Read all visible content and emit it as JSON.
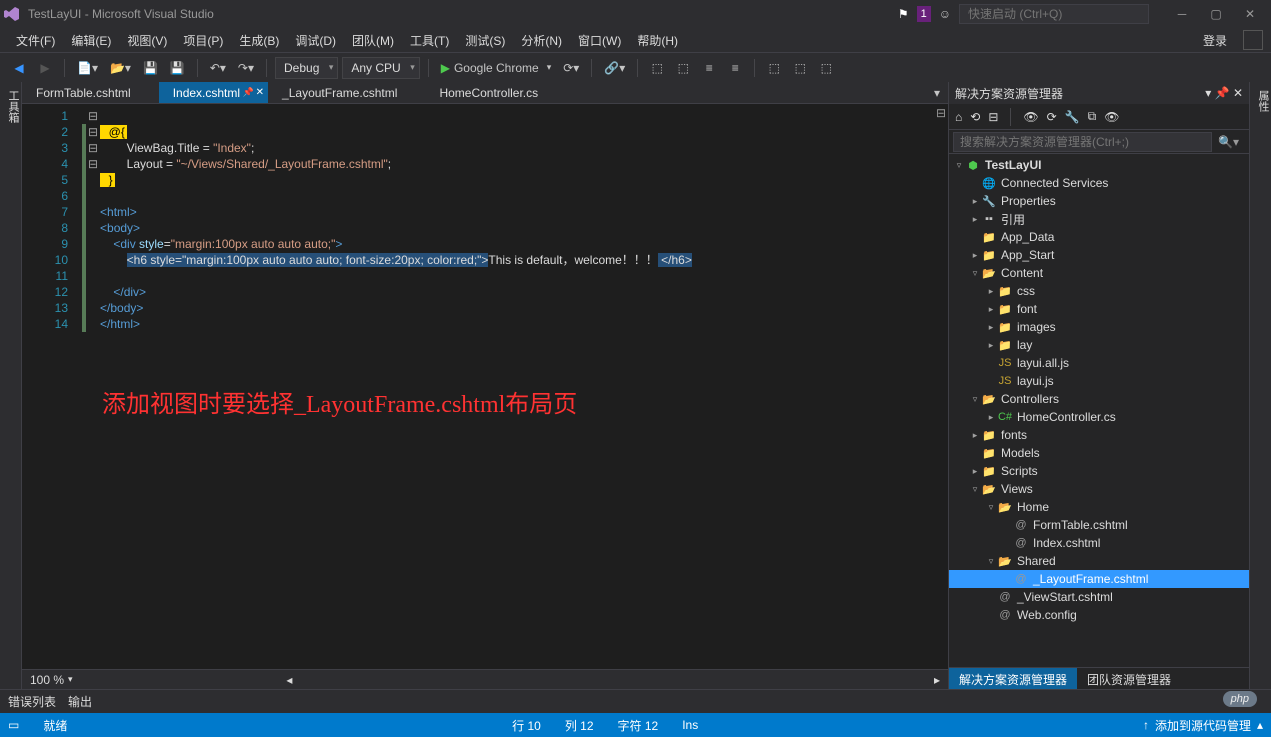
{
  "titlebar": {
    "title": "TestLayUI - Microsoft Visual Studio",
    "notification_count": "1",
    "quick_launch_placeholder": "快速启动 (Ctrl+Q)"
  },
  "menubar": {
    "items": [
      "文件(F)",
      "编辑(E)",
      "视图(V)",
      "项目(P)",
      "生成(B)",
      "调试(D)",
      "团队(M)",
      "工具(T)",
      "测试(S)",
      "分析(N)",
      "窗口(W)",
      "帮助(H)"
    ],
    "login": "登录"
  },
  "toolbar": {
    "config": "Debug",
    "platform": "Any CPU",
    "start_target": "Google Chrome"
  },
  "left_strip": "工具箱",
  "right_strip": "属性",
  "tabs": [
    {
      "label": "FormTable.cshtml",
      "active": false
    },
    {
      "label": "Index.cshtml",
      "active": true,
      "pinned": true
    },
    {
      "label": "_LayoutFrame.cshtml",
      "active": false
    },
    {
      "label": "HomeController.cs",
      "active": false
    }
  ],
  "code": {
    "lines": [
      {
        "n": 1,
        "segs": []
      },
      {
        "n": 2,
        "segs": [
          {
            "t": "@{",
            "c": "tok-yellow-box",
            "indent": 2
          }
        ]
      },
      {
        "n": 3,
        "segs": [
          {
            "t": "ViewBag.Title = ",
            "c": "tok-text",
            "indent": 8
          },
          {
            "t": "\"Index\"",
            "c": "tok-str"
          },
          {
            "t": ";",
            "c": "tok-text"
          }
        ]
      },
      {
        "n": 4,
        "segs": [
          {
            "t": "Layout = ",
            "c": "tok-text",
            "indent": 8
          },
          {
            "t": "\"~/Views/Shared/_LayoutFrame.cshtml\"",
            "c": "tok-str"
          },
          {
            "t": ";",
            "c": "tok-text"
          }
        ]
      },
      {
        "n": 5,
        "segs": [
          {
            "t": "}",
            "c": "tok-yellow-box",
            "indent": 2
          }
        ]
      },
      {
        "n": 6,
        "segs": []
      },
      {
        "n": 7,
        "segs": [
          {
            "t": "<",
            "c": "tok-tag",
            "indent": 0
          },
          {
            "t": "html",
            "c": "tok-tag"
          },
          {
            "t": ">",
            "c": "tok-tag"
          }
        ]
      },
      {
        "n": 8,
        "segs": [
          {
            "t": "<",
            "c": "tok-tag",
            "indent": 0
          },
          {
            "t": "body",
            "c": "tok-tag"
          },
          {
            "t": ">",
            "c": "tok-tag"
          }
        ]
      },
      {
        "n": 9,
        "segs": [
          {
            "t": "    ",
            "c": "tok-text"
          },
          {
            "t": "<",
            "c": "tok-tag"
          },
          {
            "t": "div ",
            "c": "tok-tag"
          },
          {
            "t": "style",
            "c": "tok-attr"
          },
          {
            "t": "=",
            "c": "tok-punct"
          },
          {
            "t": "\"margin:100px auto auto auto;\"",
            "c": "tok-str"
          },
          {
            "t": ">",
            "c": "tok-tag"
          }
        ]
      },
      {
        "n": 10,
        "segs": [
          {
            "t": "        ",
            "c": "tok-text"
          },
          {
            "t": "<h6",
            "c": "tok-highlight"
          },
          {
            "t": " style=\"margin:100px auto auto auto; font-size:20px; color:red;\">",
            "c": "tok-highlight"
          },
          {
            "t": "This is default，welcome！！！",
            "c": "tok-text"
          },
          {
            "t": " </h6>",
            "c": "tok-highlight"
          }
        ]
      },
      {
        "n": 11,
        "segs": []
      },
      {
        "n": 12,
        "segs": [
          {
            "t": "    ",
            "c": "tok-text"
          },
          {
            "t": "</",
            "c": "tok-tag"
          },
          {
            "t": "div",
            "c": "tok-tag"
          },
          {
            "t": ">",
            "c": "tok-tag"
          }
        ]
      },
      {
        "n": 13,
        "segs": [
          {
            "t": "</",
            "c": "tok-tag",
            "indent": 0
          },
          {
            "t": "body",
            "c": "tok-tag"
          },
          {
            "t": ">",
            "c": "tok-tag"
          }
        ]
      },
      {
        "n": 14,
        "segs": [
          {
            "t": "</",
            "c": "tok-tag",
            "indent": 0
          },
          {
            "t": "html",
            "c": "tok-tag"
          },
          {
            "t": ">",
            "c": "tok-tag"
          }
        ]
      }
    ],
    "annotation": "添加视图时要选择_LayoutFrame.cshtml布局页",
    "zoom": "100 %"
  },
  "solution_explorer": {
    "title": "解决方案资源管理器",
    "search_placeholder": "搜索解决方案资源管理器(Ctrl+;)",
    "tabs": {
      "active": "解决方案资源管理器",
      "other": "团队资源管理器"
    },
    "tree": [
      {
        "d": 0,
        "exp": "▿",
        "icon": "csproj",
        "label": "TestLayUI",
        "bold": true
      },
      {
        "d": 1,
        "exp": "",
        "icon": "globe",
        "label": "Connected Services"
      },
      {
        "d": 1,
        "exp": "▸",
        "icon": "wrench",
        "label": "Properties"
      },
      {
        "d": 1,
        "exp": "▸",
        "icon": "ref",
        "label": "引用"
      },
      {
        "d": 1,
        "exp": "",
        "icon": "folder",
        "label": "App_Data"
      },
      {
        "d": 1,
        "exp": "▸",
        "icon": "folder",
        "label": "App_Start"
      },
      {
        "d": 1,
        "exp": "▿",
        "icon": "folder-open",
        "label": "Content"
      },
      {
        "d": 2,
        "exp": "▸",
        "icon": "folder",
        "label": "css"
      },
      {
        "d": 2,
        "exp": "▸",
        "icon": "folder",
        "label": "font"
      },
      {
        "d": 2,
        "exp": "▸",
        "icon": "folder",
        "label": "images"
      },
      {
        "d": 2,
        "exp": "▸",
        "icon": "folder",
        "label": "lay"
      },
      {
        "d": 2,
        "exp": "",
        "icon": "js",
        "label": "layui.all.js"
      },
      {
        "d": 2,
        "exp": "",
        "icon": "js",
        "label": "layui.js"
      },
      {
        "d": 1,
        "exp": "▿",
        "icon": "folder-open",
        "label": "Controllers"
      },
      {
        "d": 2,
        "exp": "▸",
        "icon": "cs",
        "label": "HomeController.cs"
      },
      {
        "d": 1,
        "exp": "▸",
        "icon": "folder",
        "label": "fonts"
      },
      {
        "d": 1,
        "exp": "",
        "icon": "folder",
        "label": "Models"
      },
      {
        "d": 1,
        "exp": "▸",
        "icon": "folder",
        "label": "Scripts"
      },
      {
        "d": 1,
        "exp": "▿",
        "icon": "folder-open",
        "label": "Views"
      },
      {
        "d": 2,
        "exp": "▿",
        "icon": "folder-open",
        "label": "Home"
      },
      {
        "d": 3,
        "exp": "",
        "icon": "cshtml",
        "label": "FormTable.cshtml"
      },
      {
        "d": 3,
        "exp": "",
        "icon": "cshtml",
        "label": "Index.cshtml"
      },
      {
        "d": 2,
        "exp": "▿",
        "icon": "folder-open",
        "label": "Shared"
      },
      {
        "d": 3,
        "exp": "",
        "icon": "cshtml",
        "label": "_LayoutFrame.cshtml",
        "selected": true
      },
      {
        "d": 2,
        "exp": "",
        "icon": "cshtml",
        "label": "_ViewStart.cshtml"
      },
      {
        "d": 2,
        "exp": "",
        "icon": "cshtml",
        "label": "Web.config"
      }
    ]
  },
  "bottom_lists": {
    "error_list": "错误列表",
    "output": "输出"
  },
  "status": {
    "state": "就绪",
    "line": "行 10",
    "col": "列 12",
    "char": "字符 12",
    "ins": "Ins",
    "source_control": "添加到源代码管理"
  },
  "watermark": "php"
}
